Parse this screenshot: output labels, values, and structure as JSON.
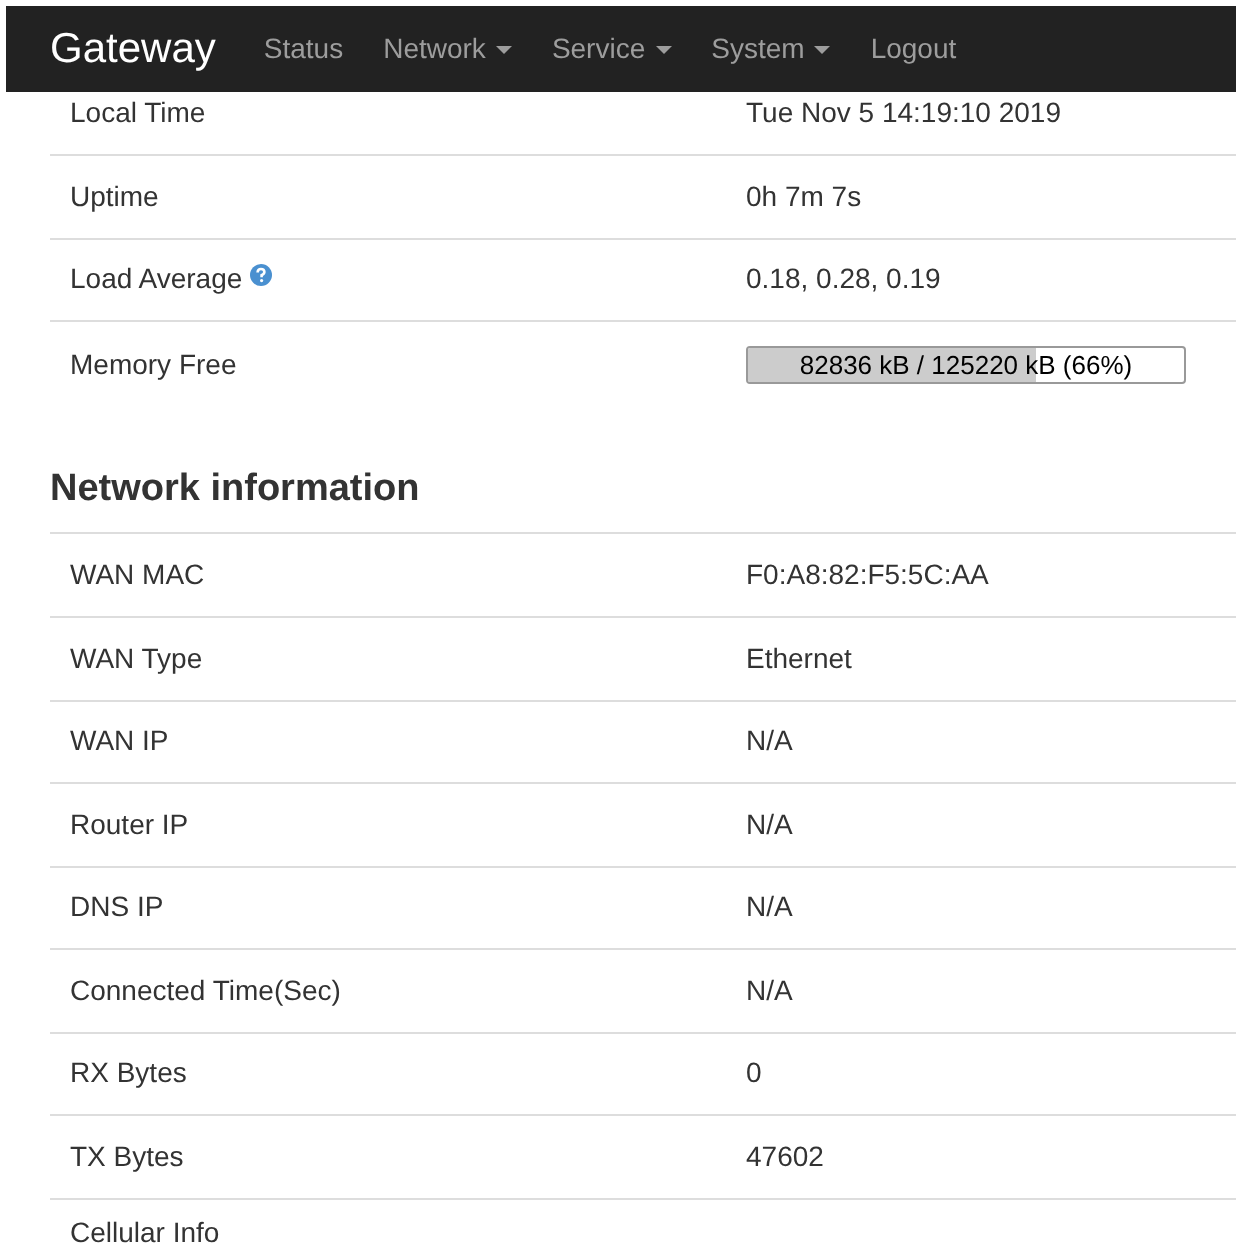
{
  "navbar": {
    "brand": "Gateway",
    "items": [
      {
        "label": "Status",
        "dropdown": false
      },
      {
        "label": "Network",
        "dropdown": true
      },
      {
        "label": "Service",
        "dropdown": true
      },
      {
        "label": "System",
        "dropdown": true
      },
      {
        "label": "Logout",
        "dropdown": false
      }
    ]
  },
  "system_rows": [
    {
      "kind": "text",
      "label": "Local Time",
      "value": "Tue Nov 5 14:19:10 2019"
    },
    {
      "kind": "text",
      "label": "Uptime",
      "value": "0h 7m 7s"
    },
    {
      "kind": "help",
      "label": "Load Average",
      "value": "0.18, 0.28, 0.19"
    },
    {
      "kind": "meter",
      "label": "Memory Free",
      "value": "82836 kB / 125220 kB (66%)",
      "level": 0.66
    }
  ],
  "network": {
    "title": "Network information",
    "rows": [
      {
        "label": "WAN MAC",
        "value": "F0:A8:82:F5:5C:AA"
      },
      {
        "label": "WAN Type",
        "value": "Ethernet"
      },
      {
        "label": "WAN IP",
        "value": "N/A"
      },
      {
        "label": "Router IP",
        "value": "N/A"
      },
      {
        "label": "DNS IP",
        "value": "N/A"
      },
      {
        "label": "Connected Time(Sec)",
        "value": "N/A"
      },
      {
        "label": "RX Bytes",
        "value": "0"
      },
      {
        "label": "TX Bytes",
        "value": "47602"
      },
      {
        "label": "Cellular Info"
      }
    ]
  }
}
